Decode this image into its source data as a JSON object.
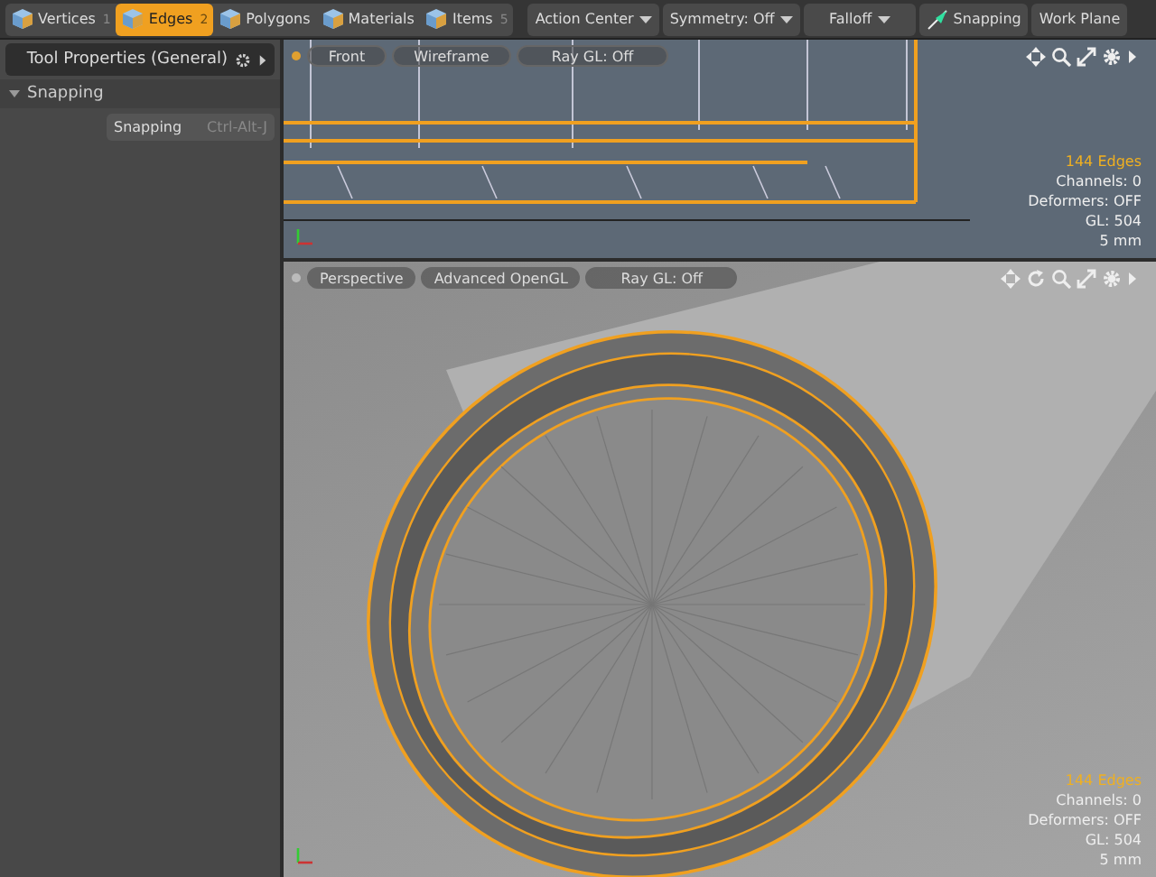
{
  "toolbar": {
    "modes": [
      {
        "label": "Vertices",
        "shortcut": "1",
        "selected": false
      },
      {
        "label": "Edges",
        "shortcut": "2",
        "selected": true
      },
      {
        "label": "Polygons",
        "selected": false
      },
      {
        "label": "Materials",
        "selected": false
      },
      {
        "label": "Items",
        "shortcut": "5",
        "selected": false
      }
    ],
    "tools": [
      {
        "label": "Action Center",
        "kind": "dropdown"
      },
      {
        "label": "Symmetry: Off",
        "kind": "dropdown"
      },
      {
        "label": "Falloff",
        "kind": "dropdown"
      },
      {
        "label": "Snapping",
        "kind": "snap"
      },
      {
        "label": "Work Plane",
        "kind": "plain"
      }
    ]
  },
  "tool_panel": {
    "title": "Tool Properties (General)",
    "section": {
      "label": "Snapping",
      "expanded": true
    },
    "rows": [
      {
        "label": "Snapping",
        "shortcut": "Ctrl-Alt-J"
      }
    ]
  },
  "viewports": [
    {
      "kind": "front",
      "buttons": [
        "Front",
        "Wireframe",
        "Ray GL: Off"
      ],
      "stats": [
        "144 Edges",
        "Channels: 0",
        "Deformers: OFF",
        "GL: 504",
        "5 mm"
      ]
    },
    {
      "kind": "perspective",
      "buttons": [
        "Perspective",
        "Advanced OpenGL",
        "Ray GL: Off"
      ],
      "stats": [
        "144 Edges",
        "Channels: 0",
        "Deformers: OFF",
        "GL: 504",
        "5 mm"
      ]
    }
  ]
}
